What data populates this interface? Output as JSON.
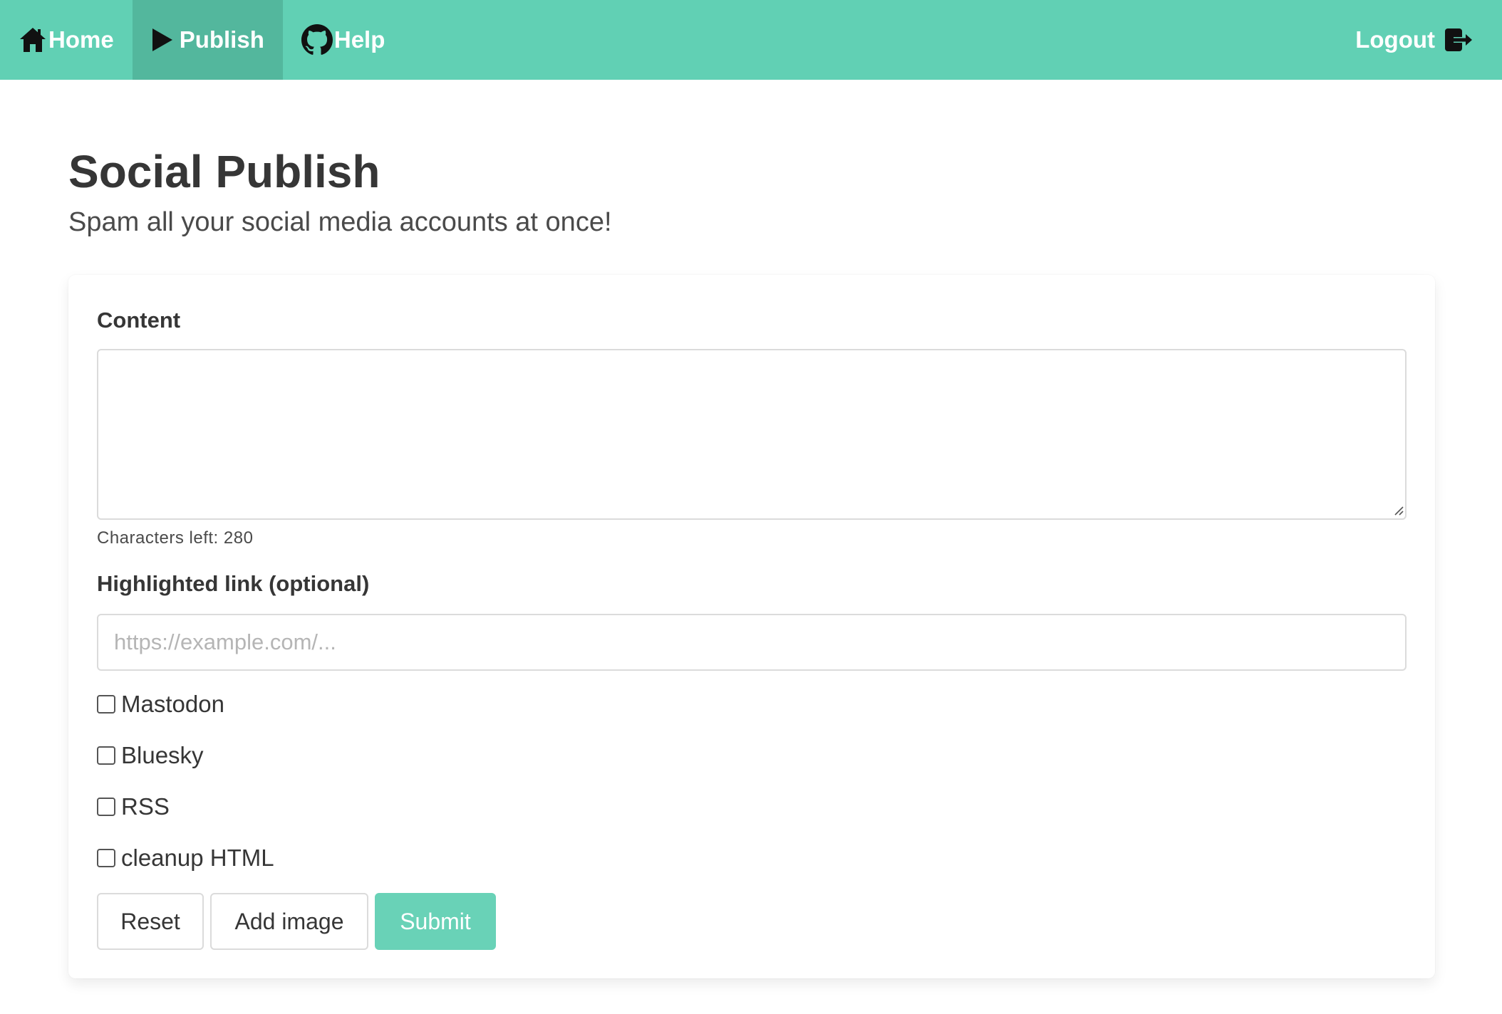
{
  "navbar": {
    "home_label": "Home",
    "publish_label": "Publish",
    "help_label": "Help",
    "logout_label": "Logout",
    "home_icon": "home-icon",
    "publish_icon": "play-icon",
    "help_icon": "github-icon",
    "logout_icon": "sign-out-icon"
  },
  "header": {
    "title": "Social Publish",
    "subtitle": "Spam all your social media accounts at once!"
  },
  "form": {
    "content_label": "Content",
    "content_value": "",
    "characters_left": "Characters left: 280",
    "link_label": "Highlighted link (optional)",
    "link_placeholder": "https://example.com/...",
    "link_value": "",
    "checkboxes": [
      {
        "label": "Mastodon",
        "checked": false
      },
      {
        "label": "Bluesky",
        "checked": false
      },
      {
        "label": "RSS",
        "checked": false
      },
      {
        "label": "cleanup HTML",
        "checked": false
      }
    ],
    "buttons": {
      "reset": "Reset",
      "add_image": "Add image",
      "submit": "Submit"
    }
  },
  "colors": {
    "primary": "#61d0b4",
    "primary_active": "#53b79d",
    "text": "#363636"
  }
}
